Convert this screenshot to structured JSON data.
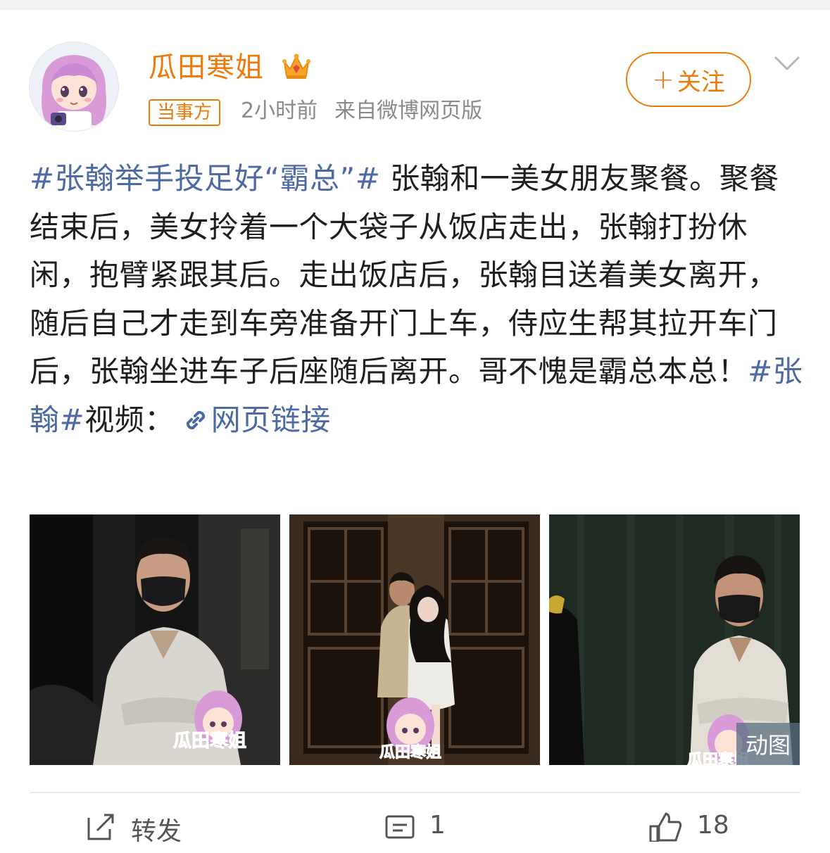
{
  "author": {
    "name": "瓜田寒姐",
    "badge": "当事方",
    "time": "2小时前",
    "source": "来自微博网页版",
    "icons": [
      "avatar",
      "crown-icon"
    ]
  },
  "follow_button": {
    "plus": "+",
    "label": "关注"
  },
  "post": {
    "topic1": "#张翰举手投足好“霸总”#",
    "text1": " 张翰和一美女朋友聚餐。聚餐结束后，美女拎着一个大袋子从饭店走出，张翰打扮休闲，抱臂紧跟其后。走出饭店后，张翰目送着美女离开，随后自己才走到车旁准备开门上车，侍应生帮其拉开车门后，张翰坐进车子后座随后离开。哥不愧是霸总本总！",
    "topic2": "#张翰#",
    "text2": "视频：",
    "link_label": "网页链接"
  },
  "images": [
    {
      "watermark": "瓜田寒姐"
    },
    {
      "watermark": "瓜田寒姐"
    },
    {
      "watermark": "瓜田寒姐",
      "badge": "动图"
    }
  ],
  "actions": {
    "repost": {
      "label": "转发",
      "icon": "repost-icon"
    },
    "comment": {
      "count": "1",
      "icon": "comment-icon"
    },
    "like": {
      "count": "18",
      "icon": "like-icon"
    }
  },
  "colors": {
    "accent": "#ec7b0b",
    "topic": "#4d6aa3",
    "meta": "#8a8a8a"
  }
}
